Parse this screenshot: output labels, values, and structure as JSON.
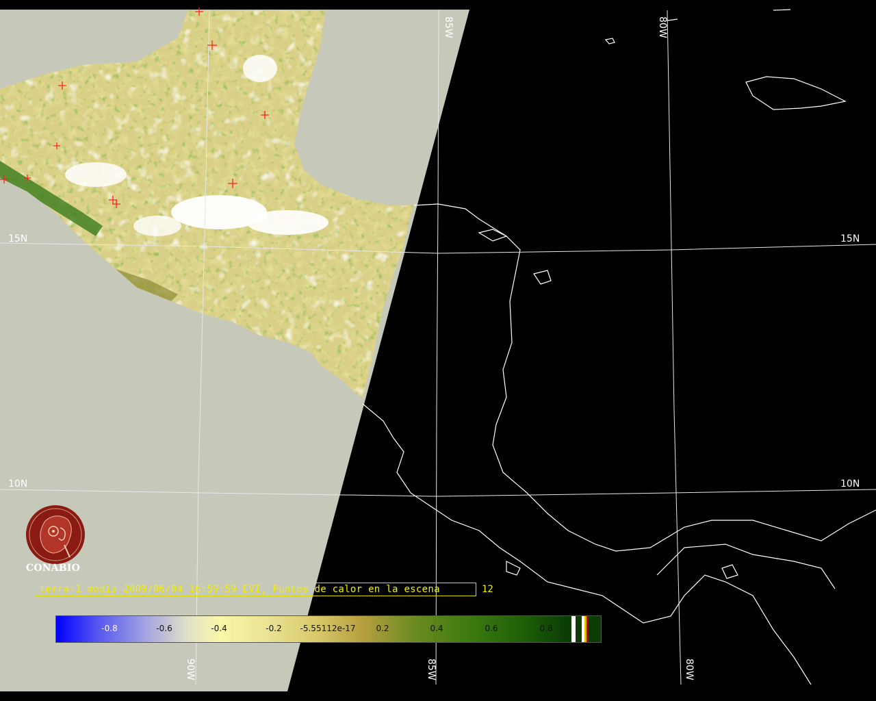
{
  "map": {
    "latitude_labels": [
      "15N",
      "10N"
    ],
    "longitude_labels": [
      "85W",
      "80W",
      "90W"
    ],
    "colors": {
      "ocean_swath": "#c6c8ba",
      "night": "#000000",
      "grid": "#e8e8e8",
      "coast": "#ffffff",
      "fire_marker": "#ff2020",
      "caption": "#f0f000"
    }
  },
  "caption": {
    "text": "terra-1 modis 2009/06/04 16:59:59 EVI, Puntos de calor en la escena",
    "fire_count": "12"
  },
  "colorbar": {
    "ticks": [
      "-0.8",
      "-0.6",
      "-0.4",
      "-0.2",
      "-5.55112e-17",
      "0.2",
      "0.4",
      "0.6",
      "0.8"
    ]
  },
  "logo": {
    "name": "CONABIO",
    "icon": "conabio-macaw-logo"
  }
}
